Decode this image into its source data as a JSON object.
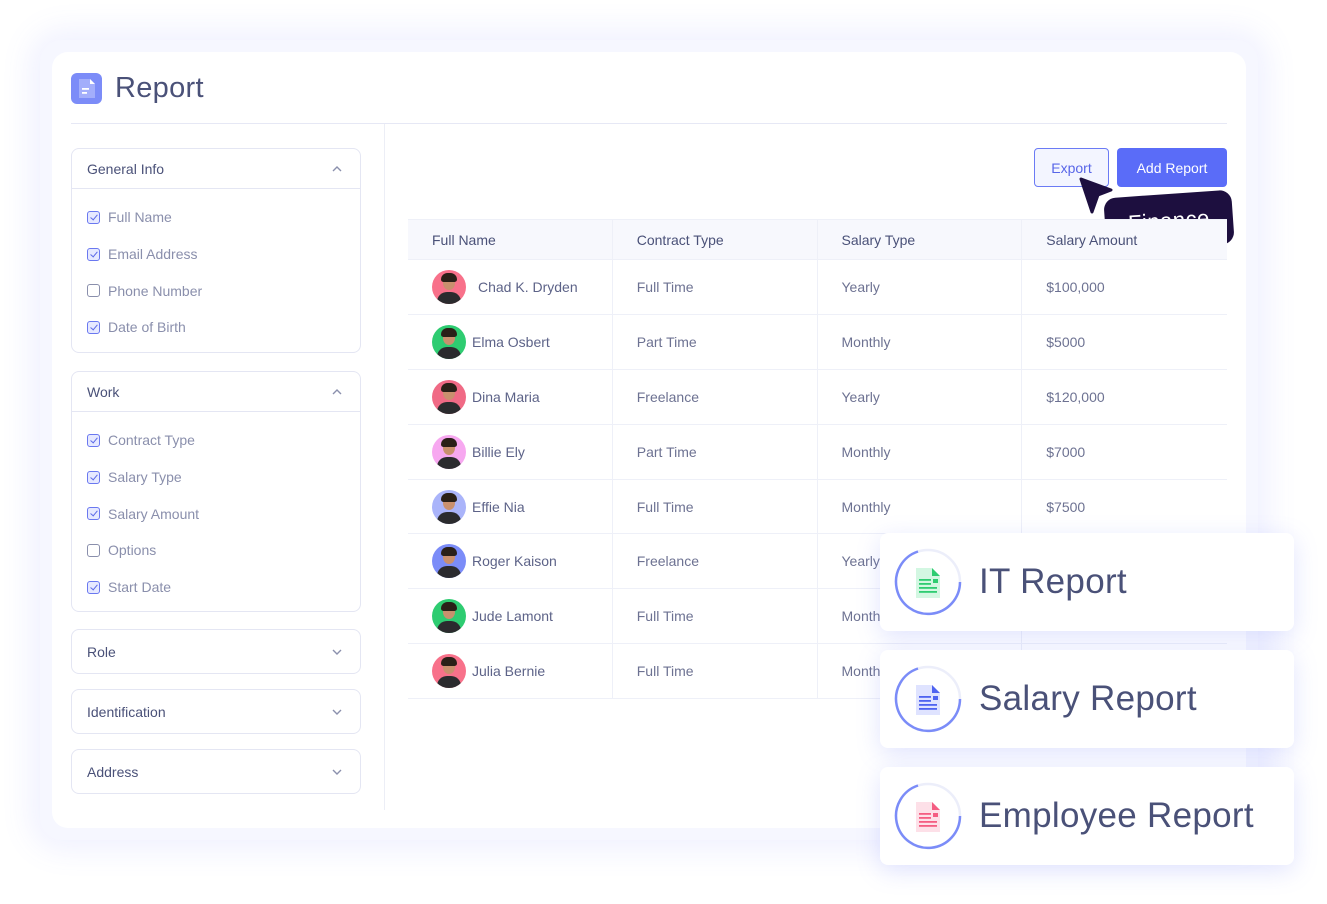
{
  "header": {
    "title": "Report",
    "icon": "document-icon"
  },
  "sidebar": {
    "sections": [
      {
        "title": "General Info",
        "expanded": true,
        "items": [
          {
            "label": "Full Name",
            "checked": true
          },
          {
            "label": "Email Address",
            "checked": true
          },
          {
            "label": "Phone Number",
            "checked": false
          },
          {
            "label": "Date of Birth",
            "checked": true
          }
        ]
      },
      {
        "title": "Work",
        "expanded": true,
        "items": [
          {
            "label": "Contract Type",
            "checked": true
          },
          {
            "label": "Salary Type",
            "checked": true
          },
          {
            "label": "Salary Amount",
            "checked": true
          },
          {
            "label": "Options",
            "checked": false
          },
          {
            "label": "Start Date",
            "checked": true
          }
        ]
      },
      {
        "title": "Role",
        "expanded": false,
        "items": []
      },
      {
        "title": "Identification",
        "expanded": false,
        "items": []
      },
      {
        "title": "Address",
        "expanded": false,
        "items": []
      }
    ]
  },
  "toolbar": {
    "export_label": "Export",
    "add_label": "Add Report"
  },
  "tooltip": {
    "label": "Finance"
  },
  "table": {
    "columns": [
      "Full Name",
      "Contract Type",
      "Salary Type",
      "Salary Amount"
    ],
    "rows": [
      {
        "name": "Chad K. Dryden",
        "contract": "Full Time",
        "salary_type": "Yearly",
        "amount": "$100,000",
        "avatar_bg": "#f8718a"
      },
      {
        "name": "Elma Osbert",
        "contract": "Part Time",
        "salary_type": "Monthly",
        "amount": "$5000",
        "avatar_bg": "#2ecc71"
      },
      {
        "name": "Dina Maria",
        "contract": "Freelance",
        "salary_type": "Yearly",
        "amount": "$120,000",
        "avatar_bg": "#f06a85"
      },
      {
        "name": "Billie Ely",
        "contract": "Part Time",
        "salary_type": "Monthly",
        "amount": "$7000",
        "avatar_bg": "#f7a8f0"
      },
      {
        "name": "Effie Nia",
        "contract": "Full Time",
        "salary_type": "Monthly",
        "amount": "$7500",
        "avatar_bg": "#aab4fa"
      },
      {
        "name": "Roger Kaison",
        "contract": "Freelance",
        "salary_type": "Yearly",
        "amount": "",
        "avatar_bg": "#7b8cf8"
      },
      {
        "name": "Jude Lamont",
        "contract": "Full Time",
        "salary_type": "Monthly",
        "amount": "",
        "avatar_bg": "#2ecc71"
      },
      {
        "name": "Julia Bernie",
        "contract": "Full Time",
        "salary_type": "Monthly",
        "amount": "",
        "avatar_bg": "#f8718a"
      }
    ]
  },
  "report_cards": [
    {
      "label": "IT Report",
      "icon": "green-document-icon",
      "color": "#2ecc71",
      "tint": "#d3f7e2"
    },
    {
      "label": "Salary Report",
      "icon": "blue-document-icon",
      "color": "#4f63f0",
      "tint": "#dfe3ff"
    },
    {
      "label": "Employee Report",
      "icon": "pink-document-icon",
      "color": "#f45d82",
      "tint": "#fde0e8"
    }
  ],
  "colors": {
    "accent": "#5a6cf8",
    "tooltip_bg": "#1d0f3f",
    "text": "#4a5178",
    "muted": "#8a8fac"
  }
}
